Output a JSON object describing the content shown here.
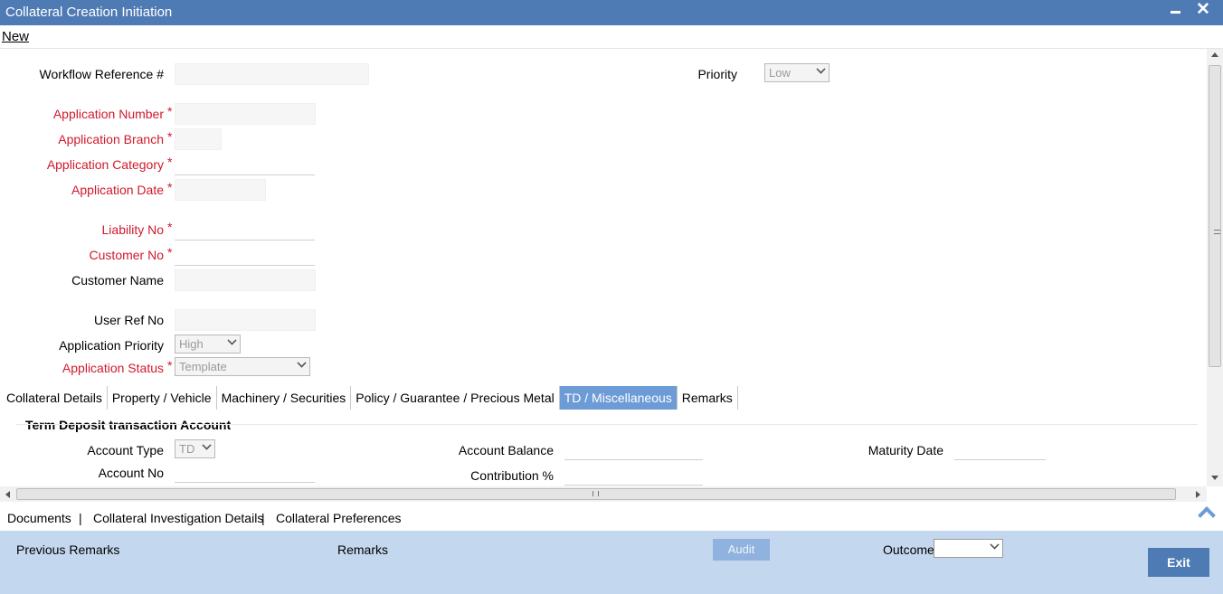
{
  "window": {
    "title": "Collateral Creation Initiation"
  },
  "menu": {
    "new_label": "New"
  },
  "form": {
    "workflow_ref": {
      "label": "Workflow Reference #",
      "value": ""
    },
    "priority": {
      "label": "Priority",
      "value": "Low"
    },
    "application_number": {
      "label": "Application Number",
      "value": ""
    },
    "application_branch": {
      "label": "Application Branch",
      "value": ""
    },
    "application_category": {
      "label": "Application Category",
      "value": ""
    },
    "application_date": {
      "label": "Application Date",
      "value": ""
    },
    "liability_no": {
      "label": "Liability No",
      "value": ""
    },
    "customer_no": {
      "label": "Customer No",
      "value": ""
    },
    "customer_name": {
      "label": "Customer Name",
      "value": ""
    },
    "user_ref_no": {
      "label": "User Ref No",
      "value": ""
    },
    "application_priority": {
      "label": "Application Priority",
      "value": "High"
    },
    "application_status": {
      "label": "Application Status",
      "value": "Template"
    },
    "required_marker": "*"
  },
  "tabs": [
    {
      "label": "Collateral Details"
    },
    {
      "label": "Property / Vehicle"
    },
    {
      "label": "Machinery / Securities"
    },
    {
      "label": "Policy / Guarantee / Precious Metal"
    },
    {
      "label": "TD / Miscellaneous"
    },
    {
      "label": "Remarks"
    }
  ],
  "td_section": {
    "title": "Term Deposit transaction Account",
    "account_type": {
      "label": "Account Type",
      "value": "TD"
    },
    "account_no": {
      "label": "Account No",
      "value": ""
    },
    "account_balance": {
      "label": "Account Balance",
      "value": ""
    },
    "contribution": {
      "label": "Contribution %",
      "value": ""
    },
    "maturity_date": {
      "label": "Maturity Date",
      "value": ""
    }
  },
  "links": {
    "documents": "Documents",
    "sep1": "|",
    "investigation": "Collateral Investigation Details",
    "sep2": "|",
    "preferences": "Collateral Preferences"
  },
  "footer": {
    "previous_remarks": "Previous Remarks",
    "remarks": "Remarks",
    "audit": "Audit",
    "outcome": {
      "label": "Outcome",
      "value": ""
    },
    "exit": "Exit"
  },
  "colors": {
    "titlebar": "#4f7bb5",
    "required": "#d0192b",
    "active_tab": "#6c9bd6",
    "footer_bg": "#c3d8ee"
  }
}
